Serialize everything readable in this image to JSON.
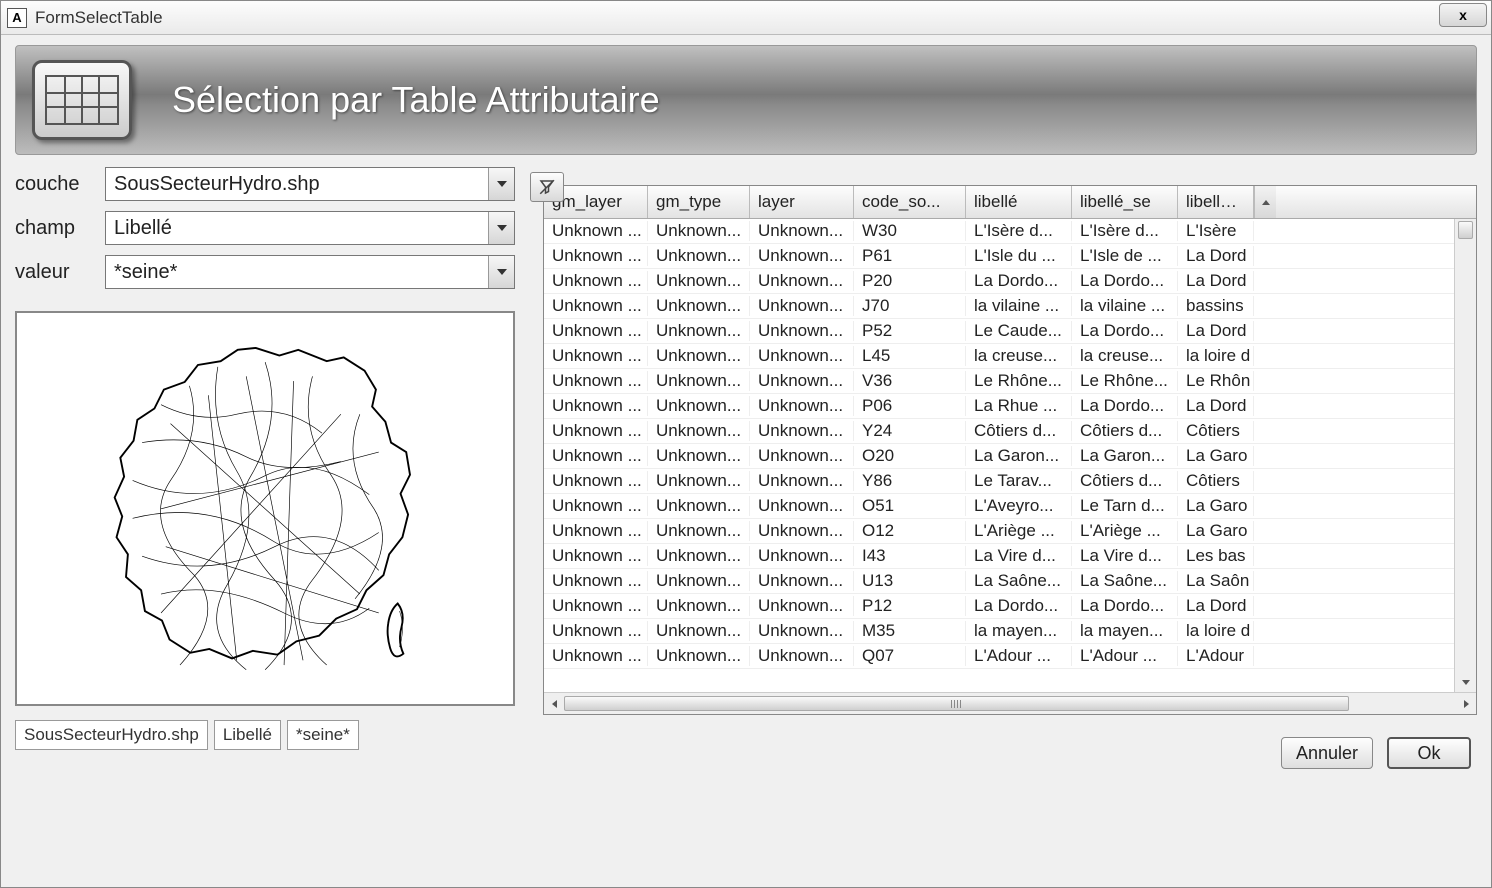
{
  "window": {
    "title": "FormSelectTable",
    "app_icon_letter": "A",
    "close_label": "x"
  },
  "banner": {
    "title": "Sélection par Table Attributaire"
  },
  "form": {
    "couche_label": "couche",
    "couche_value": "SousSecteurHydro.shp",
    "champ_label": "champ",
    "champ_value": "Libellé",
    "valeur_label": "valeur",
    "valeur_value": "*seine*"
  },
  "status": {
    "couche": "SousSecteurHydro.shp",
    "champ": "Libellé",
    "valeur": "*seine*"
  },
  "table": {
    "columns": [
      "gm_layer",
      "gm_type",
      "layer",
      "code_so...",
      "libellé",
      "libellé_se",
      "libellé_re"
    ],
    "rows": [
      [
        "Unknown ...",
        "Unknown...",
        "Unknown...",
        "W30",
        "L'Isère d...",
        "L'Isère d...",
        "L'Isère"
      ],
      [
        "Unknown ...",
        "Unknown...",
        "Unknown...",
        "P61",
        "L'Isle du ...",
        "L'Isle de ...",
        "La Dord"
      ],
      [
        "Unknown ...",
        "Unknown...",
        "Unknown...",
        "P20",
        "La Dordo...",
        "La Dordo...",
        "La Dord"
      ],
      [
        "Unknown ...",
        "Unknown...",
        "Unknown...",
        "J70",
        "la vilaine ...",
        "la vilaine ...",
        "bassins"
      ],
      [
        "Unknown ...",
        "Unknown...",
        "Unknown...",
        "P52",
        "Le Caude...",
        "La Dordo...",
        "La Dord"
      ],
      [
        "Unknown ...",
        "Unknown...",
        "Unknown...",
        "L45",
        "la creuse...",
        "la creuse...",
        "la loire d"
      ],
      [
        "Unknown ...",
        "Unknown...",
        "Unknown...",
        "V36",
        "Le Rhône...",
        "Le Rhône...",
        "Le Rhôn"
      ],
      [
        "Unknown ...",
        "Unknown...",
        "Unknown...",
        "P06",
        "La Rhue ...",
        "La Dordo...",
        "La Dord"
      ],
      [
        "Unknown ...",
        "Unknown...",
        "Unknown...",
        "Y24",
        "Côtiers d...",
        "Côtiers d...",
        "Côtiers"
      ],
      [
        "Unknown ...",
        "Unknown...",
        "Unknown...",
        "O20",
        "La Garon...",
        "La Garon...",
        "La Garo"
      ],
      [
        "Unknown ...",
        "Unknown...",
        "Unknown...",
        "Y86",
        "Le Tarav...",
        "Côtiers d...",
        "Côtiers"
      ],
      [
        "Unknown ...",
        "Unknown...",
        "Unknown...",
        "O51",
        "L'Aveyro...",
        "Le Tarn d...",
        "La Garo"
      ],
      [
        "Unknown ...",
        "Unknown...",
        "Unknown...",
        "O12",
        "L'Ariège ...",
        "L'Ariège ...",
        "La Garo"
      ],
      [
        "Unknown ...",
        "Unknown...",
        "Unknown...",
        "I43",
        "La Vire d...",
        "La Vire d...",
        "Les bas"
      ],
      [
        "Unknown ...",
        "Unknown...",
        "Unknown...",
        "U13",
        "La Saône...",
        "La Saône...",
        "La Saôn"
      ],
      [
        "Unknown ...",
        "Unknown...",
        "Unknown...",
        "P12",
        "La Dordo...",
        "La Dordo...",
        "La Dord"
      ],
      [
        "Unknown ...",
        "Unknown...",
        "Unknown...",
        "M35",
        "la mayen...",
        "la mayen...",
        "la loire d"
      ],
      [
        "Unknown ...",
        "Unknown...",
        "Unknown...",
        "Q07",
        "L'Adour ...",
        "L'Adour ...",
        "L'Adour"
      ]
    ]
  },
  "buttons": {
    "cancel": "Annuler",
    "ok": "Ok"
  }
}
